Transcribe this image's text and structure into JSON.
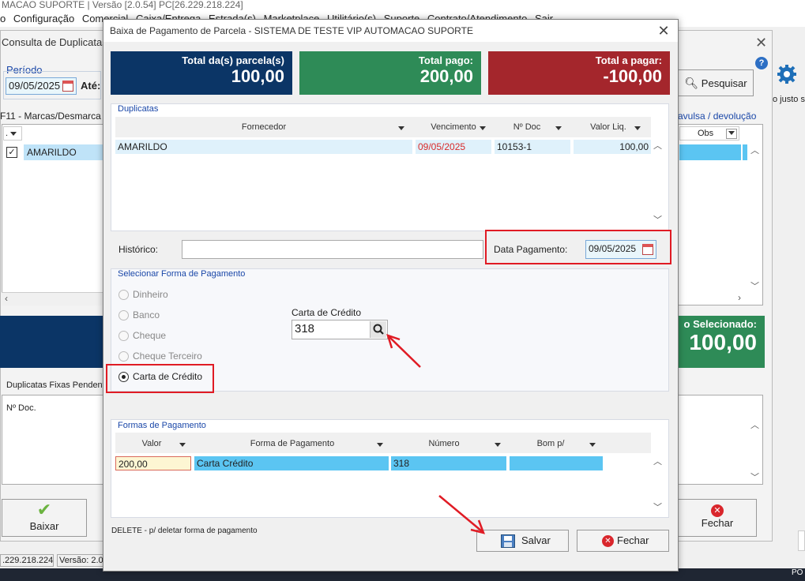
{
  "bg": {
    "title": "MACAO SUPORTE | Versão [2.0.54] PC[26.229.218.224]",
    "menu": [
      "o",
      "Configuração",
      "Comercial",
      "Caixa/Entrega",
      "Estrada(s)",
      "Marketplace",
      "Utilitário(s)",
      "Suporte",
      "Contrato/Atendimento",
      "Sair"
    ],
    "window_title": "Consulta de Duplicatas -",
    "periodo_label": "Período",
    "periodo_start": "09/05/2025",
    "ate_label": "Até:",
    "pesquisar": "Pesquisar",
    "marcas_text": "F11 - Marcas/Desmarca",
    "row_name": "AMARILDO",
    "col_dot": ".",
    "col_obs": "Obs",
    "avulsa_text": "avulsa / devolução",
    "justo_text": "o justo s",
    "selecionado_label": "o Selecionado:",
    "selecionado_value": "100,00",
    "fixas_label": "Duplicatas Fixas Pendent",
    "ndoc_label": "Nº Doc.",
    "baixar": "Baixar",
    "fechar": "Fechar",
    "status_ip": ".229.218.224",
    "status_versao": "Versão: 2.0",
    "tray_text": "PO"
  },
  "dialog": {
    "title": "Baixa de Pagamento de Parcela - SISTEMA DE TESTE VIP AUTOMACAO SUPORTE",
    "totals": [
      {
        "label": "Total da(s) parcela(s)",
        "value": "100,00",
        "color": "#0b3566"
      },
      {
        "label": "Total pago:",
        "value": "200,00",
        "color": "#2e8b57"
      },
      {
        "label": "Total a pagar:",
        "value": "-100,00",
        "color": "#a4262c"
      }
    ],
    "duplicatas": {
      "caption": "Duplicatas",
      "columns": [
        "Fornecedor",
        "Vencimento",
        "Nº Doc",
        "Valor Liq."
      ],
      "rows": [
        {
          "fornecedor": "AMARILDO",
          "vencimento": "09/05/2025",
          "ndoc": "10153-1",
          "valor": "100,00"
        }
      ]
    },
    "historico_label": "Histórico:",
    "historico_value": "",
    "data_pagamento_label": "Data Pagamento:",
    "data_pagamento_value": "09/05/2025",
    "forma": {
      "caption": "Selecionar Forma de Pagamento",
      "options": [
        "Dinheiro",
        "Banco",
        "Cheque",
        "Cheque Terceiro",
        "Carta de Crédito"
      ],
      "selected": "Carta de Crédito",
      "carta_label": "Carta de Crédito",
      "carta_value": "318"
    },
    "formas_pagamento": {
      "caption": "Formas de Pagamento",
      "columns": [
        "Valor",
        "Forma de Pagamento",
        "Número",
        "Bom p/"
      ],
      "rows": [
        {
          "valor": "200,00",
          "forma": "Carta Crédito",
          "numero": "318",
          "bom": ""
        }
      ]
    },
    "delete_hint": "DELETE - p/ deletar forma de pagamento",
    "salvar": "Salvar",
    "fechar": "Fechar"
  }
}
